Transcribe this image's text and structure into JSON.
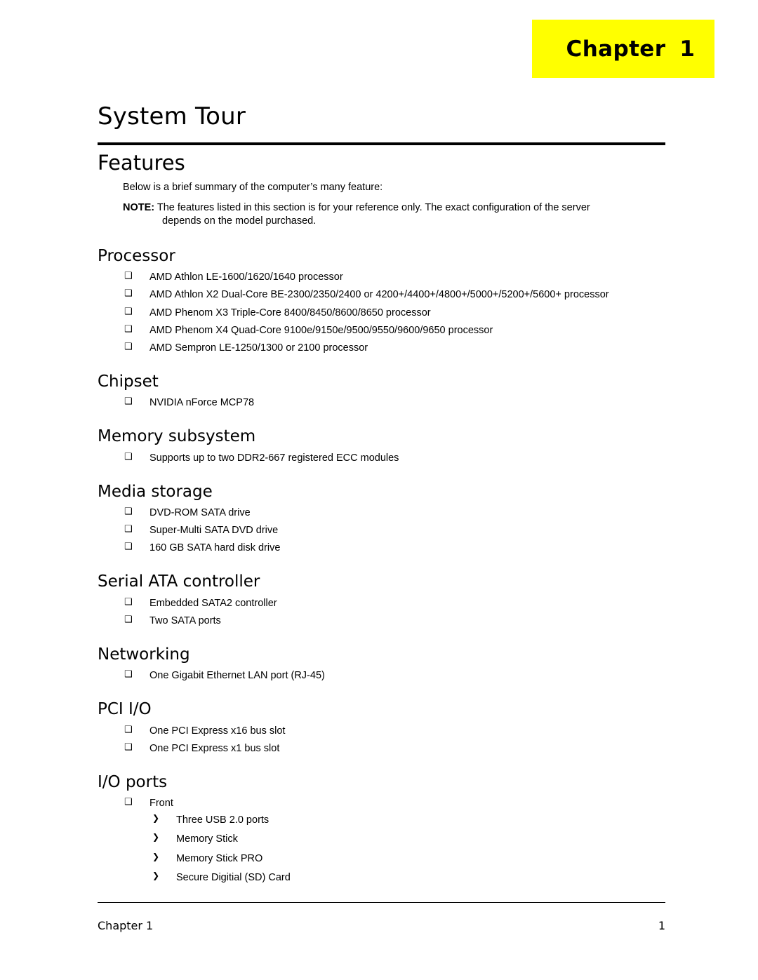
{
  "banner": {
    "chapter_word": "Chapter",
    "chapter_number": "1",
    "background_color": "#ffff00"
  },
  "title": "System Tour",
  "section_heading": "Features",
  "intro": "Below is a brief summary of the computer’s many feature:",
  "note": {
    "label": "NOTE:",
    "line1": " The features listed in this section is for your reference only. The exact configuration of the server",
    "line2": "depends on the model purchased."
  },
  "bullet_glyph": "❑",
  "sub_bullet_glyph": "❯",
  "sections": [
    {
      "heading": "Processor",
      "items": [
        "AMD Athlon LE-1600/1620/1640 processor",
        "AMD Athlon X2 Dual-Core BE-2300/2350/2400 or 4200+/4400+/4800+/5000+/5200+/5600+ processor",
        "AMD Phenom X3 Triple-Core 8400/8450/8600/8650 processor",
        "AMD Phenom X4 Quad-Core 9100e/9150e/9500/9550/9600/9650 processor",
        "AMD Sempron LE-1250/1300 or 2100 processor"
      ]
    },
    {
      "heading": "Chipset",
      "items": [
        "NVIDIA nForce MCP78"
      ]
    },
    {
      "heading": "Memory subsystem",
      "items": [
        "Supports up to two DDR2-667 registered ECC modules"
      ]
    },
    {
      "heading": "Media storage",
      "items": [
        "DVD-ROM SATA drive",
        "Super-Multi SATA DVD drive",
        "160 GB SATA hard disk drive"
      ]
    },
    {
      "heading": "Serial ATA controller",
      "items": [
        "Embedded SATA2 controller",
        "Two SATA ports"
      ]
    },
    {
      "heading": "Networking",
      "items": [
        "One Gigabit Ethernet LAN port (RJ-45)"
      ]
    },
    {
      "heading": "PCI I/O",
      "items": [
        "One PCI Express x16 bus slot",
        "One PCI Express x1 bus slot"
      ]
    },
    {
      "heading": "I/O ports",
      "items": [
        "Front"
      ],
      "sub_items": [
        "Three USB 2.0 ports",
        "Memory Stick",
        "Memory Stick PRO",
        "Secure Digitial (SD) Card"
      ]
    }
  ],
  "footer": {
    "left": "Chapter 1",
    "right": "1"
  }
}
